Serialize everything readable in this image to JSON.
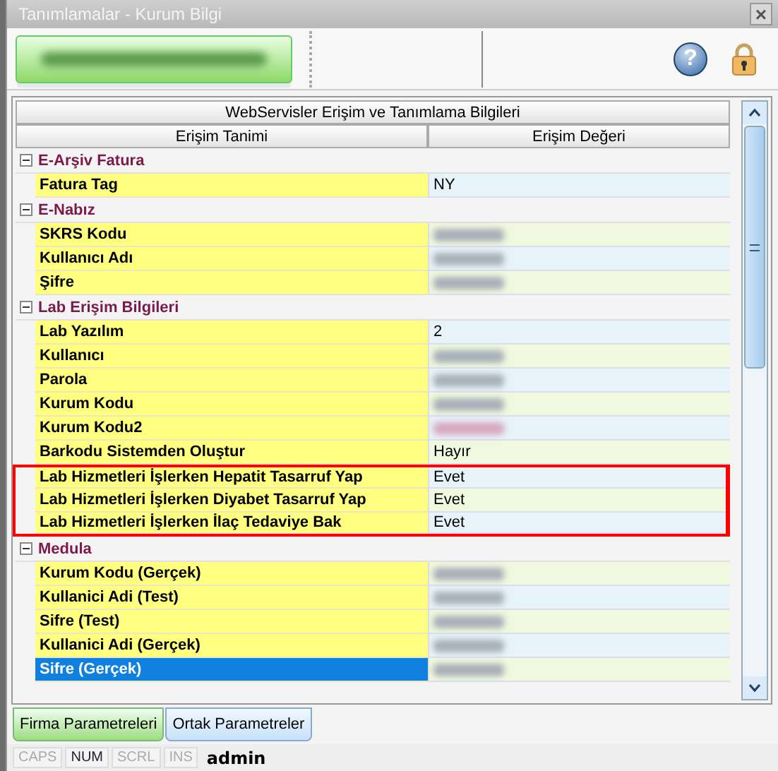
{
  "window": {
    "title": "Tanımlamalar - Kurum Bilgi",
    "close": "×"
  },
  "toolbar": {
    "main_button": {
      "redacted": true
    },
    "help": "?"
  },
  "grid": {
    "title": "WebServisler Erişim ve Tanımlama Bilgileri",
    "columns": [
      "Erişim Tanimi",
      "Erişim Değeri"
    ],
    "groups": [
      {
        "name": "E-Arşiv Fatura",
        "expanded": true,
        "rows": [
          {
            "label": "Fatura Tag",
            "value": "NY",
            "highlighted": false,
            "selected": false
          }
        ]
      },
      {
        "name": "E-Nabız",
        "expanded": true,
        "rows": [
          {
            "label": "SKRS Kodu",
            "redacted": true,
            "highlighted": false,
            "selected": false
          },
          {
            "label": "Kullanıcı Adı",
            "redacted": true,
            "highlighted": false,
            "selected": false
          },
          {
            "label": "Şifre",
            "redacted": true,
            "highlighted": false,
            "selected": false
          }
        ]
      },
      {
        "name": "Lab Erişim Bilgileri",
        "expanded": true,
        "rows": [
          {
            "label": "Lab Yazılım",
            "value": "2",
            "highlighted": false,
            "selected": false
          },
          {
            "label": "Kullanıcı",
            "redacted": true,
            "highlighted": false,
            "selected": false
          },
          {
            "label": "Parola",
            "redacted": true,
            "highlighted": false,
            "selected": false
          },
          {
            "label": "Kurum Kodu",
            "redacted": true,
            "highlighted": false,
            "selected": false
          },
          {
            "label": "Kurum Kodu2",
            "redacted": true,
            "color": "#d8a8c0",
            "highlighted": false,
            "selected": false
          },
          {
            "label": "Barkodu Sistemden Oluştur",
            "value": "Hayır",
            "highlighted": false,
            "selected": false
          },
          {
            "label": "Lab Hizmetleri İşlerken Hepatit Tasarruf Yap",
            "value": "Evet",
            "highlighted": true,
            "selected": false
          },
          {
            "label": "Lab Hizmetleri İşlerken Diyabet Tasarruf Yap",
            "value": "Evet",
            "highlighted": true,
            "selected": false
          },
          {
            "label": "Lab Hizmetleri İşlerken İlaç Tedaviye Bak",
            "value": "Evet",
            "highlighted": true,
            "selected": false
          }
        ]
      },
      {
        "name": "Medula",
        "expanded": true,
        "rows": [
          {
            "label": "Kurum Kodu (Gerçek)",
            "redacted": true,
            "highlighted": false,
            "selected": false
          },
          {
            "label": "Kullanici Adi (Test)",
            "redacted": true,
            "highlighted": false,
            "selected": false
          },
          {
            "label": "Sifre (Test)",
            "redacted": true,
            "highlighted": false,
            "selected": false
          },
          {
            "label": "Kullanici Adi (Gerçek)",
            "redacted": true,
            "highlighted": false,
            "selected": false
          },
          {
            "label": "Sifre (Gerçek)",
            "redacted": true,
            "highlighted": false,
            "selected": true
          }
        ]
      }
    ]
  },
  "tabs": [
    {
      "label": "Firma Parametreleri",
      "selected": true
    },
    {
      "label": "Ortak Parametreler",
      "selected": false
    }
  ],
  "status_bar": {
    "keys": [
      {
        "label": "CAPS",
        "on": false
      },
      {
        "label": "NUM",
        "on": true
      },
      {
        "label": "SCRL",
        "on": false
      },
      {
        "label": "INS",
        "on": false
      }
    ],
    "user": "admin"
  }
}
